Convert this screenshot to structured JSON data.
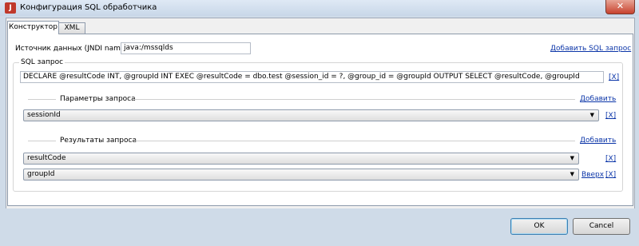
{
  "window": {
    "title": "Конфигурация SQL обработчика",
    "close_glyph": "✕"
  },
  "tabs": [
    {
      "label": "Конструктор"
    },
    {
      "label": "XML"
    }
  ],
  "datasource": {
    "label": "Источник данных (JNDI name)",
    "value": "java:/mssqlds"
  },
  "add_sql_link": "Добавить SQL запрос",
  "sql": {
    "legend": "SQL запрос",
    "query": "DECLARE @resultCode INT, @groupId INT  EXEC @resultCode = dbo.test @session_id = ?, @group_id = @groupId OUTPUT  SELECT @resultCode, @groupId",
    "remove": "[X]"
  },
  "params": {
    "legend": "Параметры запроса",
    "add": "Добавить",
    "items": [
      {
        "value": "sessionId",
        "remove": "[X]"
      }
    ]
  },
  "results": {
    "legend": "Результаты запроса",
    "add": "Добавить",
    "items": [
      {
        "value": "resultCode",
        "remove": "[X]"
      },
      {
        "value": "groupId",
        "up": "Вверх",
        "remove": "[X]"
      }
    ]
  },
  "buttons": {
    "ok": "OK",
    "cancel": "Cancel"
  }
}
